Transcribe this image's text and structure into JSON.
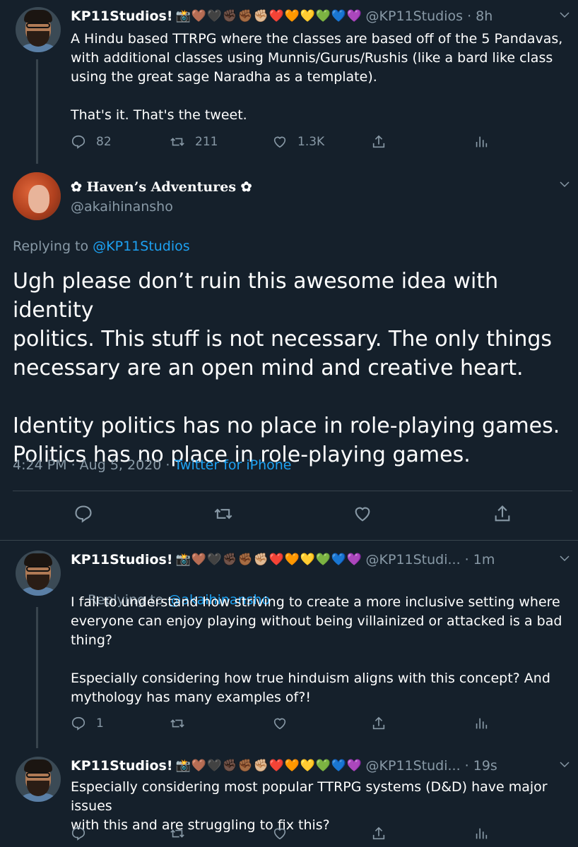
{
  "tweet1": {
    "name": "KP11Studios!",
    "emojis": [
      "📸",
      "🤎",
      "🖤",
      "✊🏿",
      "✊🏾",
      "✊🏼",
      "❤️",
      "🧡",
      "💛",
      "💚",
      "💙",
      "💜"
    ],
    "handle_time": "@KP11Studios · 8h",
    "text": "A Hindu based TTRPG where the classes are based off of the 5 Pandavas,\nwith additional classes using Munnis/Gurus/Rushis (like a bard like class\nusing the great sage Naradha as a template).\n\nThat's it. That's the tweet.",
    "replies": "82",
    "retweets": "211",
    "likes": "1.3K"
  },
  "main": {
    "name": "✿ Haven’s Adventures ✿",
    "handle": "@akaihinansho",
    "replying_prefix": "Replying to ",
    "replying_to": "@KP11Studios",
    "text": "Ugh please don’t ruin this awesome idea with identity\npolitics. This stuff is not necessary. The only things\nnecessary are an open mind and creative heart.\n\nIdentity politics has no place in role-playing games.\nPolitics has no place in role-playing games.",
    "timestamp": "4:24 PM · Aug 5, 2020 · ",
    "source": "Twitter for iPhone"
  },
  "tweet2": {
    "name": "KP11Studios!",
    "handle_time": "@KP11Studi... · 1m",
    "replying_prefix": "Replying to ",
    "replying_to": "@akaihinansho",
    "text": "I fail to understand how striving to create a more inclusive setting where\neveryone can enjoy playing without being villainized or attacked is a bad\nthing?\n\nEspecially considering how true hinduism aligns with this concept? And\nmythology has many examples of?!",
    "replies": "1"
  },
  "tweet3": {
    "name": "KP11Studios!",
    "handle_time": "@KP11Studi... · 19s",
    "text": "Especially considering most popular TTRPG systems (D&D) have major issues\nwith this and are struggling to fix this?"
  },
  "colors": {
    "background": "#15202b",
    "accent": "#1da1f2",
    "muted": "#8899a6",
    "divider": "#38444d"
  }
}
